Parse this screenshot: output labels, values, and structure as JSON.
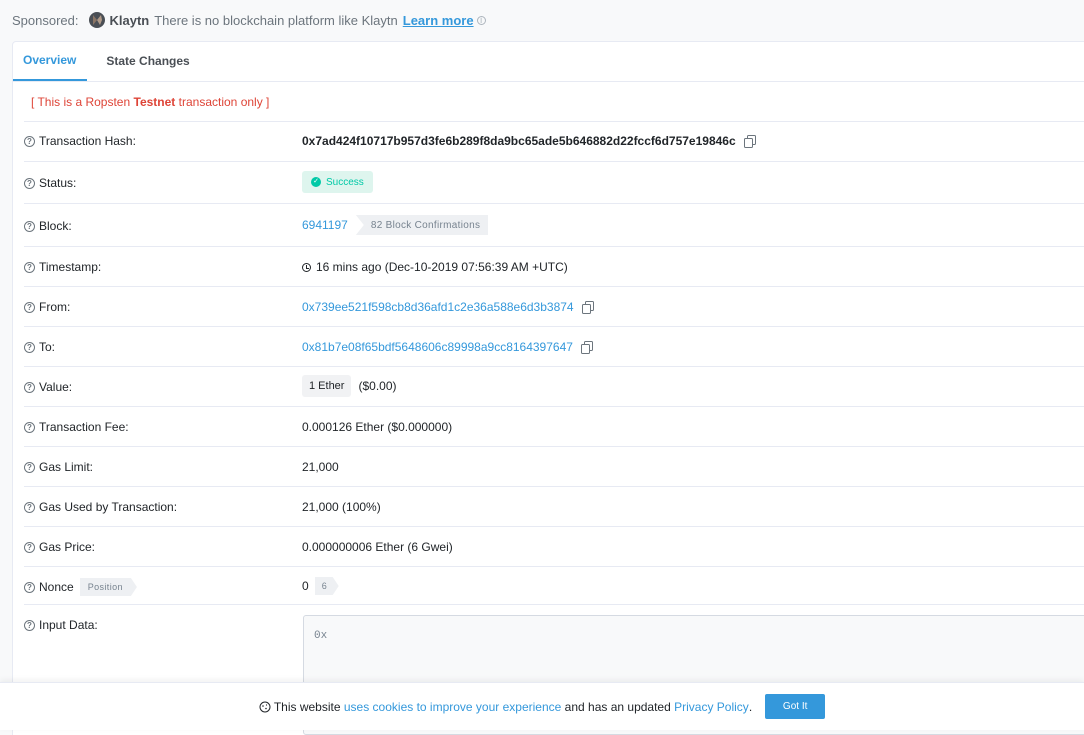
{
  "sponsored": {
    "label": "Sponsored:",
    "brand": "Klaytn",
    "text": "There is no blockchain platform like Klaytn",
    "link": "Learn more",
    "info_icon": "info-icon"
  },
  "tabs": [
    {
      "label": "Overview",
      "active": true
    },
    {
      "label": "State Changes",
      "active": false
    }
  ],
  "testnet": {
    "prefix": "[ This is a Ropsten",
    "bold": "Testnet",
    "suffix": "transaction only ]"
  },
  "fields": {
    "tx_hash": {
      "label": "Transaction Hash:",
      "value": "0x7ad424f10717b957d3fe6b289f8da9bc65ade5b646882d22fccf6d757e19846c"
    },
    "status": {
      "label": "Status:",
      "value": "Success"
    },
    "block": {
      "label": "Block:",
      "value": "6941197",
      "confirmations": "82 Block Confirmations"
    },
    "timestamp": {
      "label": "Timestamp:",
      "value": "16 mins ago (Dec-10-2019 07:56:39 AM +UTC)"
    },
    "from": {
      "label": "From:",
      "value": "0x739ee521f598cb8d36afd1c2e36a588e6d3b3874"
    },
    "to": {
      "label": "To:",
      "value": "0x81b7e08f65bdf5648606c89998a9cc8164397647"
    },
    "value": {
      "label": "Value:",
      "amount": "1 Ether",
      "usd": "($0.00)"
    },
    "tx_fee": {
      "label": "Transaction Fee:",
      "value": "0.000126 Ether ($0.000000)"
    },
    "gas_limit": {
      "label": "Gas Limit:",
      "value": "21,000"
    },
    "gas_used": {
      "label": "Gas Used by Transaction:",
      "value": "21,000 (100%)"
    },
    "gas_price": {
      "label": "Gas Price:",
      "value": "0.000000006 Ether (6 Gwei)"
    },
    "nonce": {
      "label": "Nonce",
      "position_label": "Position",
      "value": "0",
      "position": "6"
    },
    "input_data": {
      "label": "Input Data:",
      "value": "0x"
    }
  },
  "cookie": {
    "prefix": "This website",
    "link1": "uses cookies to improve your experience",
    "middle": "and has an updated",
    "link2": "Privacy Policy",
    "suffix": ".",
    "button": "Got It"
  },
  "colors": {
    "link": "#3498db",
    "success": "#00c9a7",
    "testnet": "#de4437"
  }
}
